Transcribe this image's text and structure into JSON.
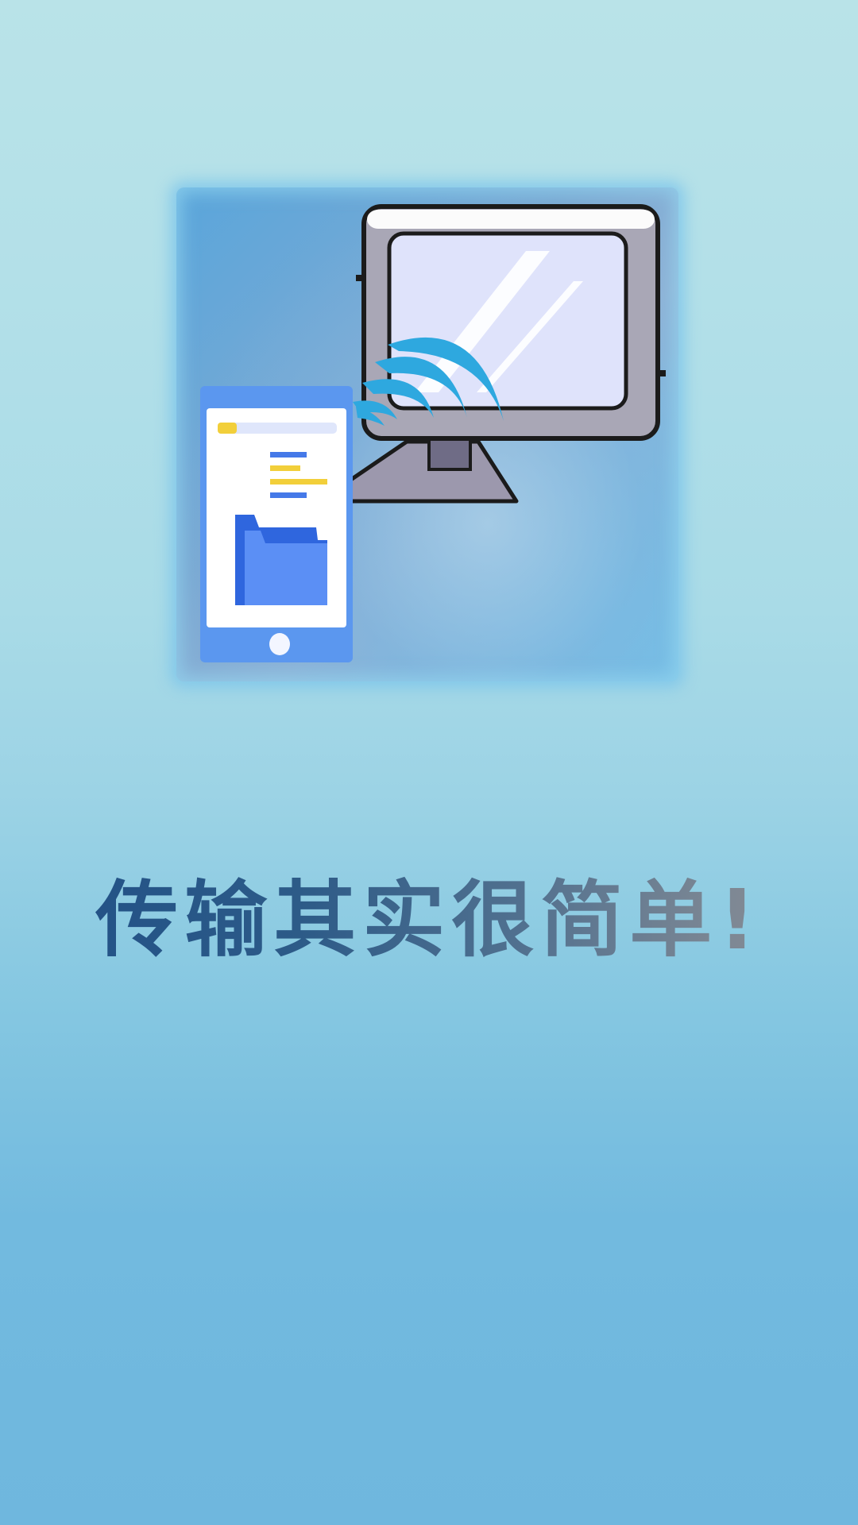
{
  "screen": {
    "headline": "传输其实很简单!"
  },
  "illustration": {
    "icons": [
      "phone-icon",
      "folder-icon",
      "wireless-signal-icon",
      "monitor-icon"
    ]
  },
  "colors": {
    "background_top": "#b9e3e8",
    "background_bottom": "#6fb7de",
    "card_blue": "#5aa6db",
    "phone_blue": "#4f8ff0",
    "folder_blue": "#3f7ff2",
    "signal_blue": "#2ea8df",
    "accent_yellow": "#f2cf3a",
    "monitor_gray": "#a9a7b6",
    "headline_blue": "#1f4f86",
    "headline_gray": "#8a8f96"
  }
}
